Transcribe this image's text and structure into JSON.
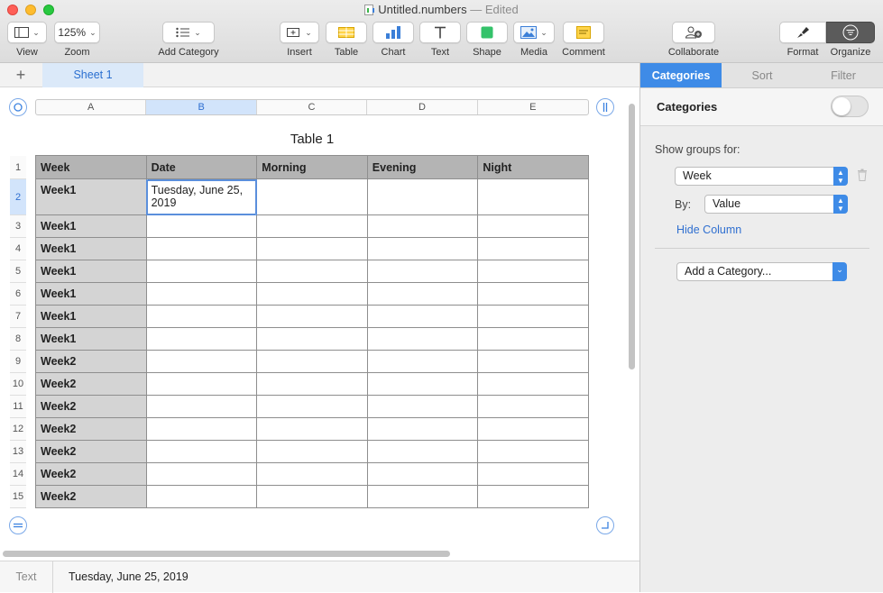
{
  "window": {
    "title": "Untitled.numbers",
    "status": "— Edited"
  },
  "toolbar": {
    "view_label": "View",
    "zoom_value": "125%",
    "zoom_label": "Zoom",
    "add_category_label": "Add Category",
    "insert_label": "Insert",
    "table_label": "Table",
    "chart_label": "Chart",
    "text_label": "Text",
    "shape_label": "Shape",
    "media_label": "Media",
    "comment_label": "Comment",
    "collaborate_label": "Collaborate",
    "format_label": "Format",
    "organize_label": "Organize"
  },
  "sheets": {
    "add": "+",
    "active": "Sheet 1"
  },
  "grid": {
    "columns": [
      "A",
      "B",
      "C",
      "D",
      "E"
    ],
    "selected_column": "B",
    "rows": [
      "1",
      "2",
      "3",
      "4",
      "5",
      "6",
      "7",
      "8",
      "9",
      "10",
      "11",
      "12",
      "13",
      "14",
      "15"
    ],
    "selected_row": "2"
  },
  "table": {
    "title": "Table 1",
    "headers": [
      "Week",
      "Date",
      "Morning",
      "Evening",
      "Night"
    ],
    "rows": [
      [
        "Week1",
        "Tuesday, June 25, 2019",
        "",
        "",
        ""
      ],
      [
        "Week1",
        "",
        "",
        "",
        ""
      ],
      [
        "Week1",
        "",
        "",
        "",
        ""
      ],
      [
        "Week1",
        "",
        "",
        "",
        ""
      ],
      [
        "Week1",
        "",
        "",
        "",
        ""
      ],
      [
        "Week1",
        "",
        "",
        "",
        ""
      ],
      [
        "Week1",
        "",
        "",
        "",
        ""
      ],
      [
        "Week2",
        "",
        "",
        "",
        ""
      ],
      [
        "Week2",
        "",
        "",
        "",
        ""
      ],
      [
        "Week2",
        "",
        "",
        "",
        ""
      ],
      [
        "Week2",
        "",
        "",
        "",
        ""
      ],
      [
        "Week2",
        "",
        "",
        "",
        ""
      ],
      [
        "Week2",
        "",
        "",
        "",
        ""
      ],
      [
        "Week2",
        "",
        "",
        "",
        ""
      ]
    ]
  },
  "statusbar": {
    "label": "Text",
    "value": "Tuesday, June 25, 2019"
  },
  "panel": {
    "tabs": [
      "Categories",
      "Sort",
      "Filter"
    ],
    "active_tab": "Categories",
    "heading": "Categories",
    "toggle_on": false,
    "show_groups_label": "Show groups for:",
    "group_column": "Week",
    "by_label": "By:",
    "by_value": "Value",
    "hide_column": "Hide Column",
    "add_category": "Add a Category..."
  },
  "colors": {
    "accent": "#3e8be7",
    "header_fill": "#b4b4b4",
    "header_column_fill": "#d4d4d4"
  }
}
